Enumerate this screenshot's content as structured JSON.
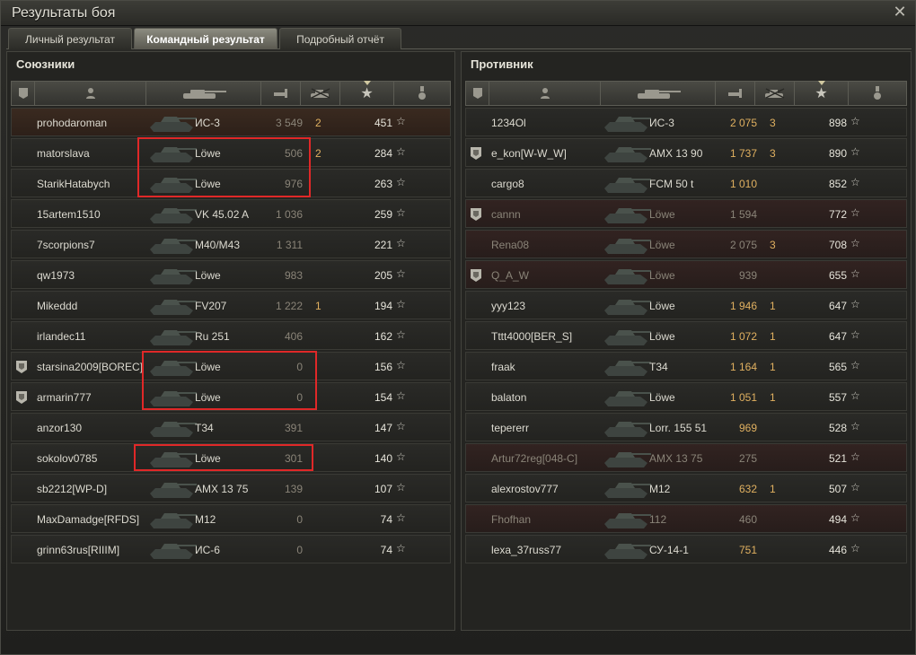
{
  "window": {
    "title": "Результаты боя"
  },
  "tabs": [
    {
      "label": "Личный результат",
      "active": false
    },
    {
      "label": "Командный результат",
      "active": true
    },
    {
      "label": "Подробный отчёт",
      "active": false
    }
  ],
  "allies": {
    "title": "Союзники",
    "players": [
      {
        "name": "prohodaroman",
        "vehicle": "ИС-3",
        "damage": "3 549",
        "kills": "2",
        "xp": "451",
        "dead": false,
        "mine": true,
        "badge": false,
        "dmg_dim": true
      },
      {
        "name": "matorslava",
        "vehicle": "Löwe",
        "damage": "506",
        "kills": "2",
        "xp": "284",
        "dead": false,
        "mine": false,
        "badge": false,
        "dmg_dim": true
      },
      {
        "name": "StarikHatabych",
        "vehicle": "Löwe",
        "damage": "976",
        "kills": "",
        "xp": "263",
        "dead": false,
        "mine": false,
        "badge": false,
        "dmg_dim": true
      },
      {
        "name": "15artem1510",
        "vehicle": "VK 45.02 A",
        "damage": "1 036",
        "kills": "",
        "xp": "259",
        "dead": false,
        "mine": false,
        "badge": false,
        "dmg_dim": true
      },
      {
        "name": "7scorpions7",
        "vehicle": "M40/M43",
        "damage": "1 311",
        "kills": "",
        "xp": "221",
        "dead": false,
        "mine": false,
        "badge": false,
        "dmg_dim": true
      },
      {
        "name": "qw1973",
        "vehicle": "Löwe",
        "damage": "983",
        "kills": "",
        "xp": "205",
        "dead": false,
        "mine": false,
        "badge": false,
        "dmg_dim": true
      },
      {
        "name": "Mikeddd",
        "vehicle": "FV207",
        "damage": "1 222",
        "kills": "1",
        "xp": "194",
        "dead": false,
        "mine": false,
        "badge": false,
        "dmg_dim": true
      },
      {
        "name": "irlandec11",
        "vehicle": "Ru 251",
        "damage": "406",
        "kills": "",
        "xp": "162",
        "dead": false,
        "mine": false,
        "badge": false,
        "dmg_dim": true
      },
      {
        "name": "starsina2009[BOREC]",
        "vehicle": "Löwe",
        "damage": "0",
        "kills": "",
        "xp": "156",
        "dead": false,
        "mine": false,
        "badge": true,
        "dmg_dim": true
      },
      {
        "name": "armarin777",
        "vehicle": "Löwe",
        "damage": "0",
        "kills": "",
        "xp": "154",
        "dead": false,
        "mine": false,
        "badge": true,
        "dmg_dim": true
      },
      {
        "name": "anzor130",
        "vehicle": "T34",
        "damage": "391",
        "kills": "",
        "xp": "147",
        "dead": false,
        "mine": false,
        "badge": false,
        "dmg_dim": true
      },
      {
        "name": "sokolov0785",
        "vehicle": "Löwe",
        "damage": "301",
        "kills": "",
        "xp": "140",
        "dead": false,
        "mine": false,
        "badge": false,
        "dmg_dim": true
      },
      {
        "name": "sb2212[WP-D]",
        "vehicle": "AMX 13 75",
        "damage": "139",
        "kills": "",
        "xp": "107",
        "dead": false,
        "mine": false,
        "badge": false,
        "dmg_dim": true
      },
      {
        "name": "MaxDamadge[RFDS]",
        "vehicle": "M12",
        "damage": "0",
        "kills": "",
        "xp": "74",
        "dead": false,
        "mine": false,
        "badge": false,
        "dmg_dim": true
      },
      {
        "name": "grinn63rus[RIIIM]",
        "vehicle": "ИС-6",
        "damage": "0",
        "kills": "",
        "xp": "74",
        "dead": false,
        "mine": false,
        "badge": false,
        "dmg_dim": true
      }
    ]
  },
  "enemies": {
    "title": "Противник",
    "players": [
      {
        "name": "1234Ol",
        "vehicle": "ИС-3",
        "damage": "2 075",
        "kills": "3",
        "xp": "898",
        "dead": false,
        "badge": false
      },
      {
        "name": "e_kon[W-W_W]",
        "vehicle": "AMX 13 90",
        "damage": "1 737",
        "kills": "3",
        "xp": "890",
        "dead": false,
        "badge": true
      },
      {
        "name": "cargo8",
        "vehicle": "FCM 50 t",
        "damage": "1 010",
        "kills": "",
        "xp": "852",
        "dead": false,
        "badge": false
      },
      {
        "name": "cannn",
        "vehicle": "Löwe",
        "damage": "1 594",
        "kills": "",
        "xp": "772",
        "dead": true,
        "badge": true
      },
      {
        "name": "Rena08",
        "vehicle": "Löwe",
        "damage": "2 075",
        "kills": "3",
        "xp": "708",
        "dead": true,
        "badge": false
      },
      {
        "name": "Q_A_W",
        "vehicle": "Löwe",
        "damage": "939",
        "kills": "",
        "xp": "655",
        "dead": true,
        "badge": true
      },
      {
        "name": "yyy123",
        "vehicle": "Löwe",
        "damage": "1 946",
        "kills": "1",
        "xp": "647",
        "dead": false,
        "badge": false
      },
      {
        "name": "Tttt4000[BER_S]",
        "vehicle": "Löwe",
        "damage": "1 072",
        "kills": "1",
        "xp": "647",
        "dead": false,
        "badge": false
      },
      {
        "name": "fraak",
        "vehicle": "T34",
        "damage": "1 164",
        "kills": "1",
        "xp": "565",
        "dead": false,
        "badge": false
      },
      {
        "name": "balaton",
        "vehicle": "Löwe",
        "damage": "1 051",
        "kills": "1",
        "xp": "557",
        "dead": false,
        "badge": false
      },
      {
        "name": "tepererr",
        "vehicle": "Lorr. 155 51",
        "damage": "969",
        "kills": "",
        "xp": "528",
        "dead": false,
        "badge": false
      },
      {
        "name": "Artur72reg[048-C]",
        "vehicle": "AMX 13 75",
        "damage": "275",
        "kills": "",
        "xp": "521",
        "dead": true,
        "badge": false
      },
      {
        "name": "alexrostov777",
        "vehicle": "M12",
        "damage": "632",
        "kills": "1",
        "xp": "507",
        "dead": false,
        "badge": false
      },
      {
        "name": "Fhofhan",
        "vehicle": "112",
        "damage": "460",
        "kills": "",
        "xp": "494",
        "dead": true,
        "badge": false
      },
      {
        "name": "lexa_37russ77",
        "vehicle": "СУ-14-1",
        "damage": "751",
        "kills": "",
        "xp": "446",
        "dead": false,
        "badge": false
      }
    ]
  },
  "columns": [
    "badge-icon",
    "player-icon",
    "vehicle-icon",
    "damage-icon",
    "kills-icon",
    "xp-star-icon",
    "medal-icon"
  ],
  "colors": {
    "damage": "#e0b060",
    "dead_row": "#322321",
    "highlight": "#e02828"
  }
}
